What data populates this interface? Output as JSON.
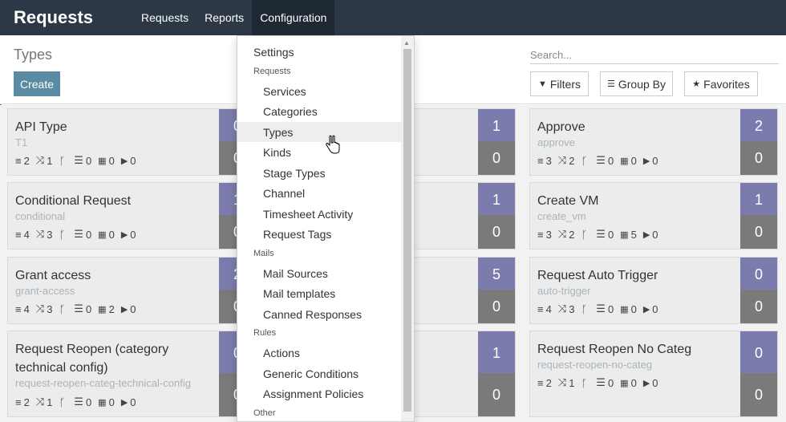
{
  "app": {
    "title": "Requests"
  },
  "nav": {
    "items": [
      "Requests",
      "Reports",
      "Configuration"
    ]
  },
  "control_panel": {
    "title": "Types",
    "create_label": "Create",
    "search_placeholder": "Search...",
    "filters_label": "Filters",
    "groupby_label": "Group By",
    "favorites_label": "Favorites"
  },
  "cards": [
    {
      "name": "API Type",
      "code": "T1",
      "stats": [
        "2",
        "1",
        "",
        "0",
        "0",
        "0"
      ],
      "top": "0",
      "bottom": "0"
    },
    {
      "name": "",
      "code": "",
      "stats": [],
      "top": "1",
      "bottom": "0"
    },
    {
      "name": "Approve",
      "code": "approve",
      "stats": [
        "3",
        "2",
        "",
        "0",
        "0",
        "0"
      ],
      "top": "2",
      "bottom": "0"
    },
    {
      "name": "Conditional Request",
      "code": "conditional",
      "stats": [
        "4",
        "3",
        "",
        "0",
        "0",
        "0"
      ],
      "top": "1",
      "bottom": "0"
    },
    {
      "name": "",
      "code": "",
      "stats": [],
      "top": "1",
      "bottom": "0"
    },
    {
      "name": "Create VM",
      "code": "create_vm",
      "stats": [
        "3",
        "2",
        "",
        "0",
        "5",
        "0"
      ],
      "top": "1",
      "bottom": "0"
    },
    {
      "name": "Grant access",
      "code": "grant-access",
      "stats": [
        "4",
        "3",
        "",
        "0",
        "2",
        "0"
      ],
      "top": "2",
      "bottom": "0"
    },
    {
      "name": "",
      "code": "",
      "stats": [],
      "top": "5",
      "bottom": "0"
    },
    {
      "name": "Request Auto Trigger",
      "code": "auto-trigger",
      "stats": [
        "4",
        "3",
        "",
        "0",
        "0",
        "0"
      ],
      "top": "0",
      "bottom": "0"
    },
    {
      "name": "Request Reopen (category technical config)",
      "code": "request-reopen-categ-technical-config",
      "stats": [
        "2",
        "1",
        "",
        "0",
        "0",
        "0"
      ],
      "top": "0",
      "bottom": "0"
    },
    {
      "name": "",
      "code": "",
      "stats": [],
      "top": "1",
      "bottom": "0"
    },
    {
      "name": "Request Reopen No Categ",
      "code": "request-reopen-no-categ",
      "stats": [
        "2",
        "1",
        "",
        "0",
        "0",
        "0"
      ],
      "top": "0",
      "bottom": "0"
    }
  ],
  "dropdown": {
    "items": [
      {
        "kind": "top",
        "label": "Settings"
      },
      {
        "kind": "header",
        "label": "Requests"
      },
      {
        "kind": "sub",
        "label": "Services"
      },
      {
        "kind": "sub",
        "label": "Categories"
      },
      {
        "kind": "sub",
        "label": "Types",
        "hover": true
      },
      {
        "kind": "sub",
        "label": "Kinds"
      },
      {
        "kind": "sub",
        "label": "Stage Types"
      },
      {
        "kind": "sub",
        "label": "Channel"
      },
      {
        "kind": "sub",
        "label": "Timesheet Activity"
      },
      {
        "kind": "sub",
        "label": "Request Tags"
      },
      {
        "kind": "header",
        "label": "Mails"
      },
      {
        "kind": "sub",
        "label": "Mail Sources"
      },
      {
        "kind": "sub",
        "label": "Mail templates"
      },
      {
        "kind": "sub",
        "label": "Canned Responses"
      },
      {
        "kind": "header",
        "label": "Rules"
      },
      {
        "kind": "sub",
        "label": "Actions"
      },
      {
        "kind": "sub",
        "label": "Generic Conditions"
      },
      {
        "kind": "sub",
        "label": "Assignment Policies"
      },
      {
        "kind": "header",
        "label": "Other"
      }
    ]
  },
  "colors": {
    "topbar": "#2c3845",
    "create": "#5b8ba2",
    "count_top": "#7c7bad",
    "count_bottom": "#7a7a7a"
  }
}
